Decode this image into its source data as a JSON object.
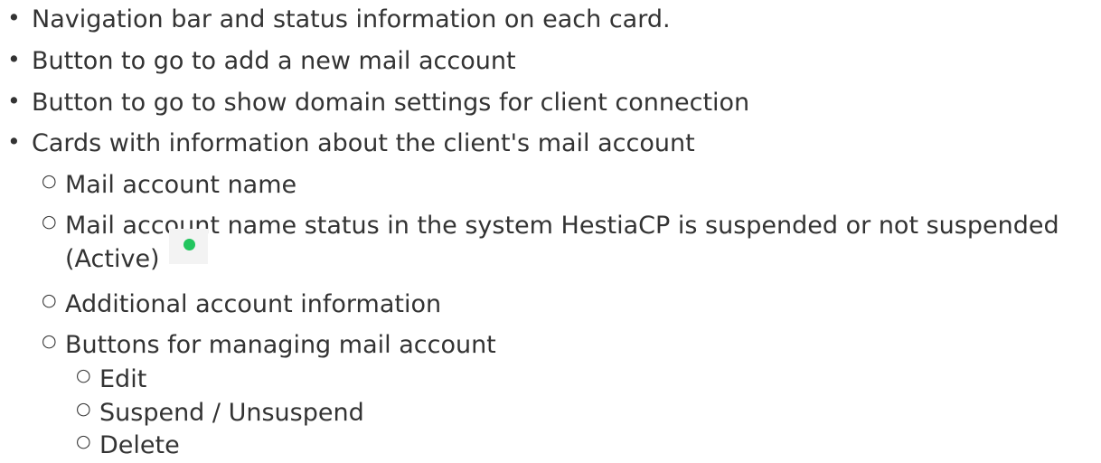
{
  "bullets": {
    "item1": "Navigation bar and status information on each card.",
    "item2": "Button to go to add a new mail account",
    "item3": "Button to go to show domain settings for client connection",
    "item4": "Cards with information about the client's mail account",
    "sub1": "Mail account name",
    "sub2_line1": "Mail account name status in the system HestiaCP is suspended or not suspended",
    "sub2_line2": "(Active)",
    "sub3": "Additional account information",
    "sub4": "Buttons for managing mail account",
    "subsub1": "Edit",
    "subsub2": "Suspend / Unsuspend",
    "subsub3": "Delete"
  },
  "markers": {
    "bullet": "•",
    "circle": "○"
  },
  "colors": {
    "text": "#333333",
    "active_status": "#22c55e"
  },
  "icons": {
    "status": "active-status-dot-icon"
  }
}
